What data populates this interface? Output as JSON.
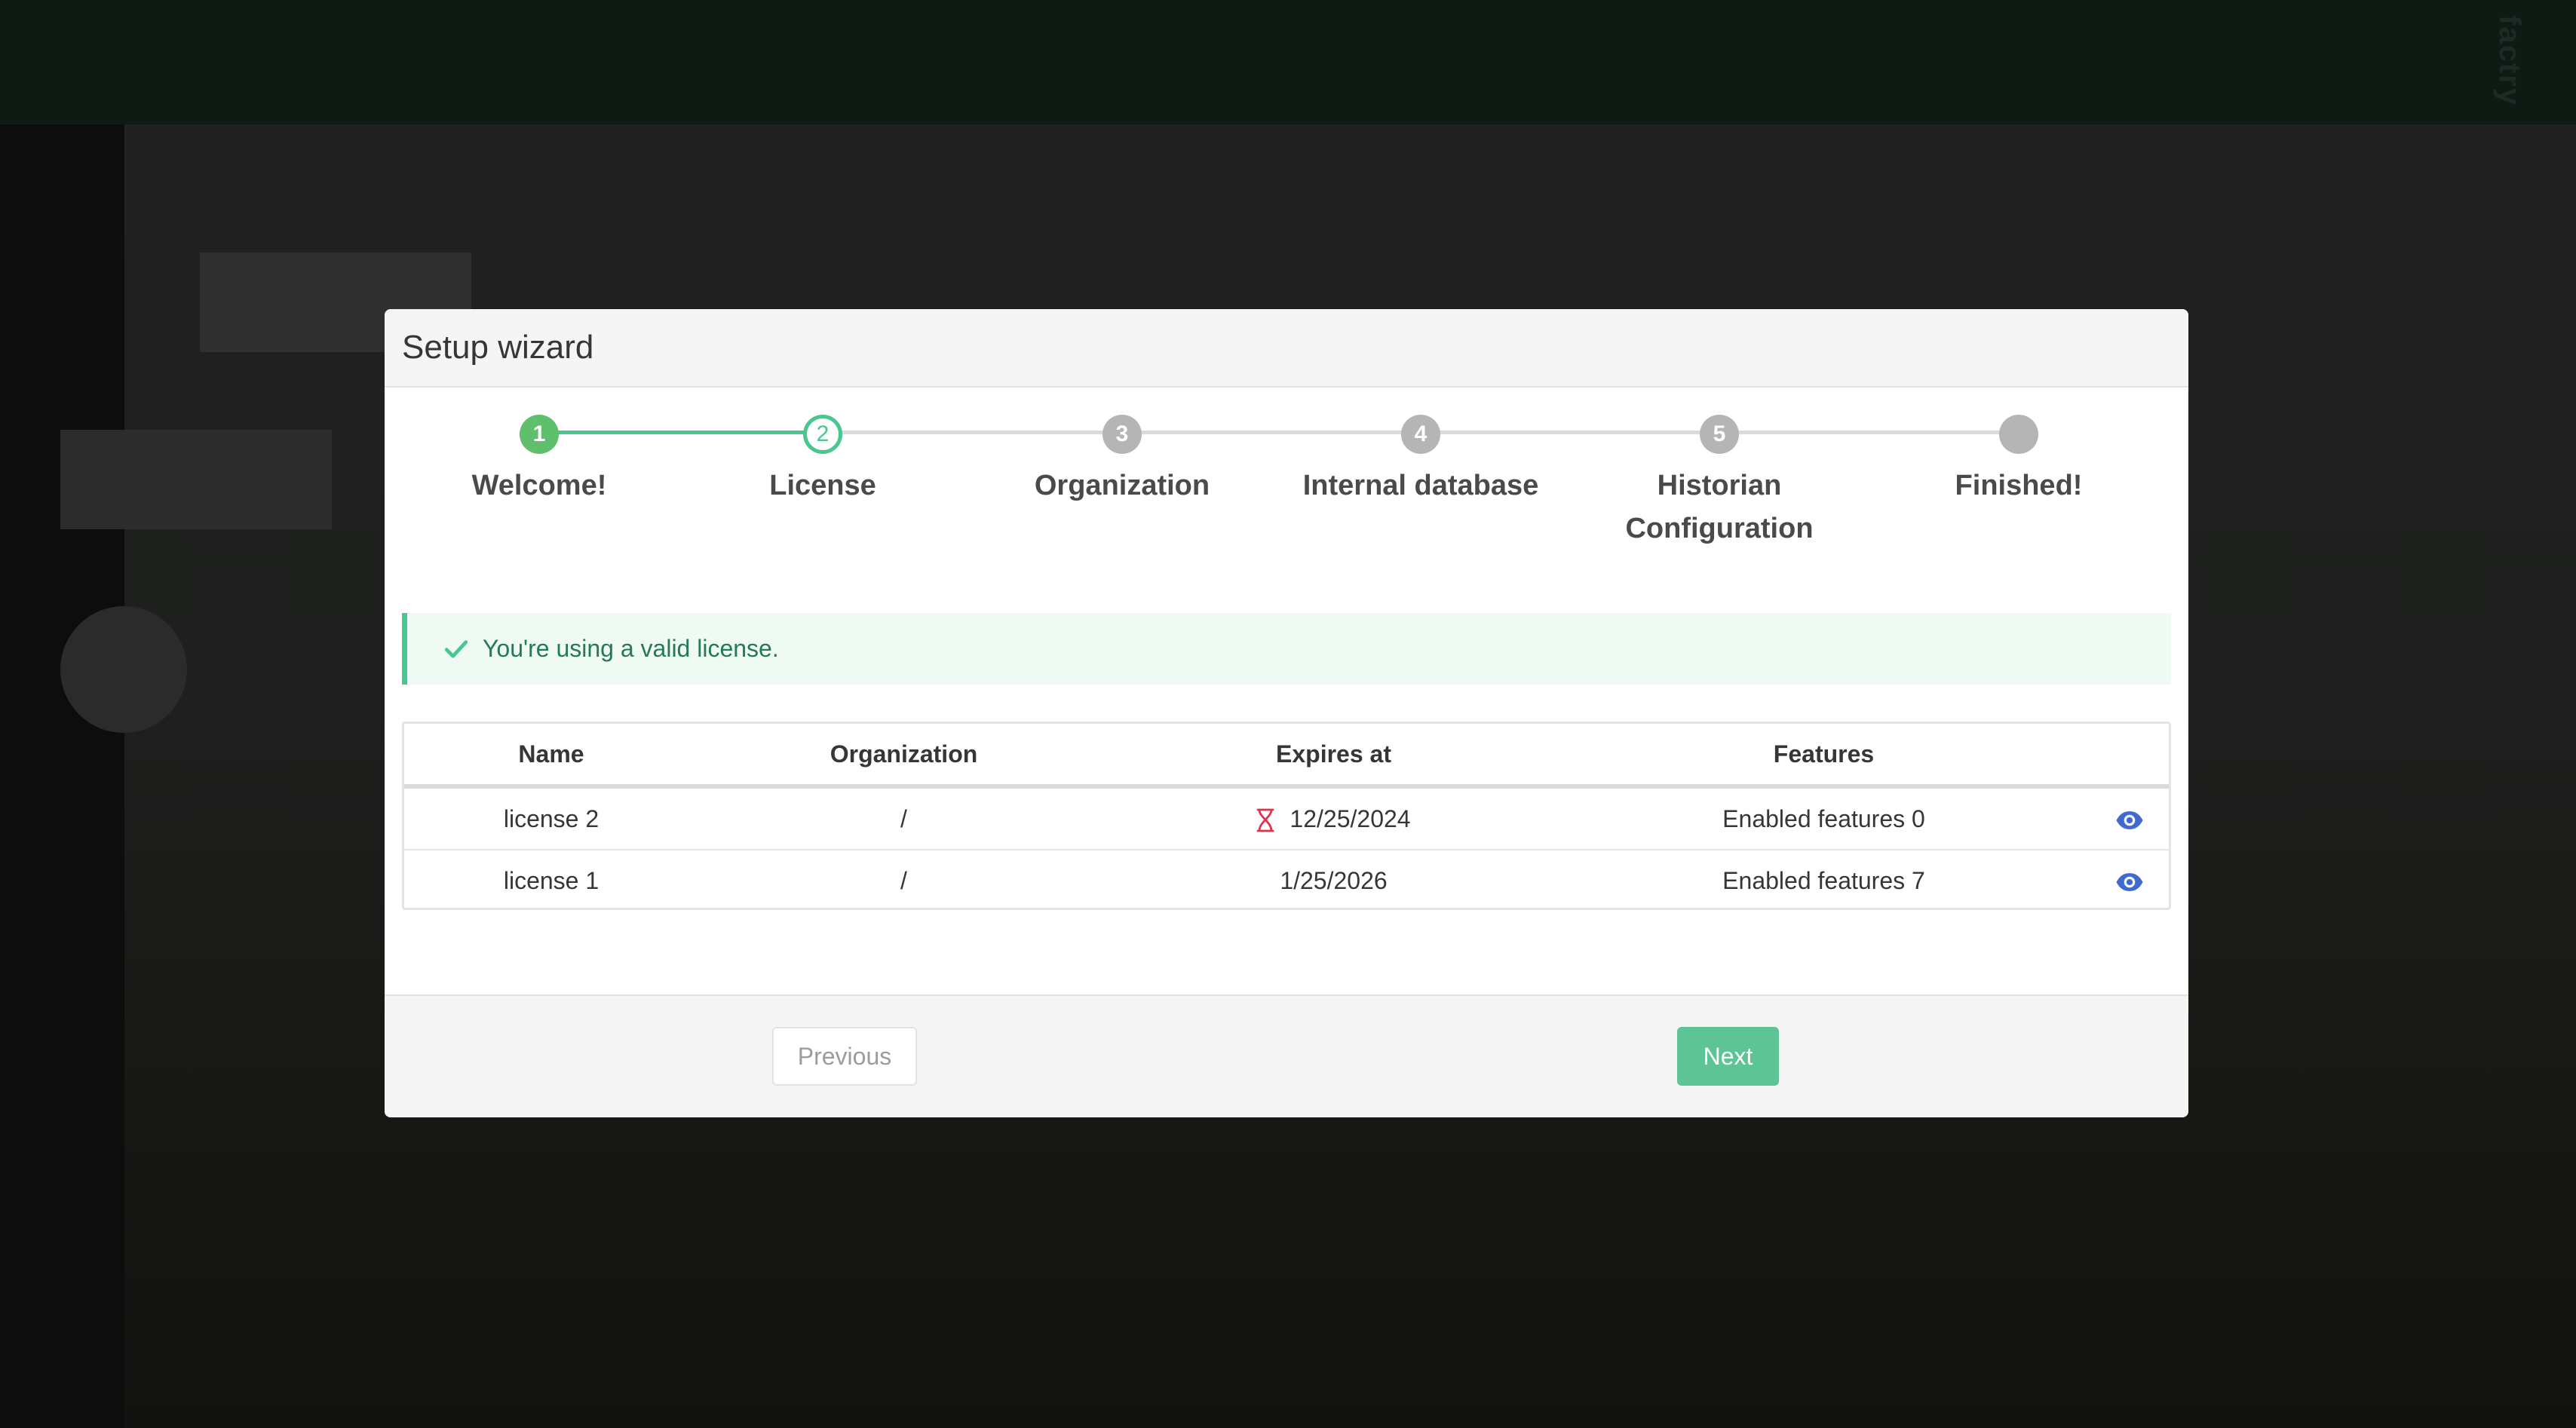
{
  "background": {
    "brand": "factry"
  },
  "modal": {
    "title": "Setup wizard"
  },
  "steps": [
    {
      "marker": "1",
      "label": "Welcome!",
      "state": "done"
    },
    {
      "marker": "2",
      "label": "License",
      "state": "active"
    },
    {
      "marker": "3",
      "label": "Organization",
      "state": "pending"
    },
    {
      "marker": "4",
      "label": "Internal database",
      "state": "pending"
    },
    {
      "marker": "5",
      "label": "Historian Configuration",
      "state": "pending"
    },
    {
      "marker": "",
      "label": "Finished!",
      "state": "pending"
    }
  ],
  "notice": {
    "text": "You're using a valid license.",
    "icon": "check-icon",
    "color": "#48c78e"
  },
  "table": {
    "headers": [
      "Name",
      "Organization",
      "Expires at",
      "Features"
    ],
    "rows": [
      {
        "name": "license 2",
        "organization": "/",
        "expires": "12/25/2024",
        "expired": true,
        "features": "Enabled features 0"
      },
      {
        "name": "license 1",
        "organization": "/",
        "expires": "1/25/2026",
        "expired": false,
        "features": "Enabled features 7"
      }
    ]
  },
  "footer": {
    "previous_label": "Previous",
    "next_label": "Next"
  },
  "colors": {
    "accent": "#48c78e",
    "expired": "#e0324d",
    "link": "#3e6ad1"
  }
}
